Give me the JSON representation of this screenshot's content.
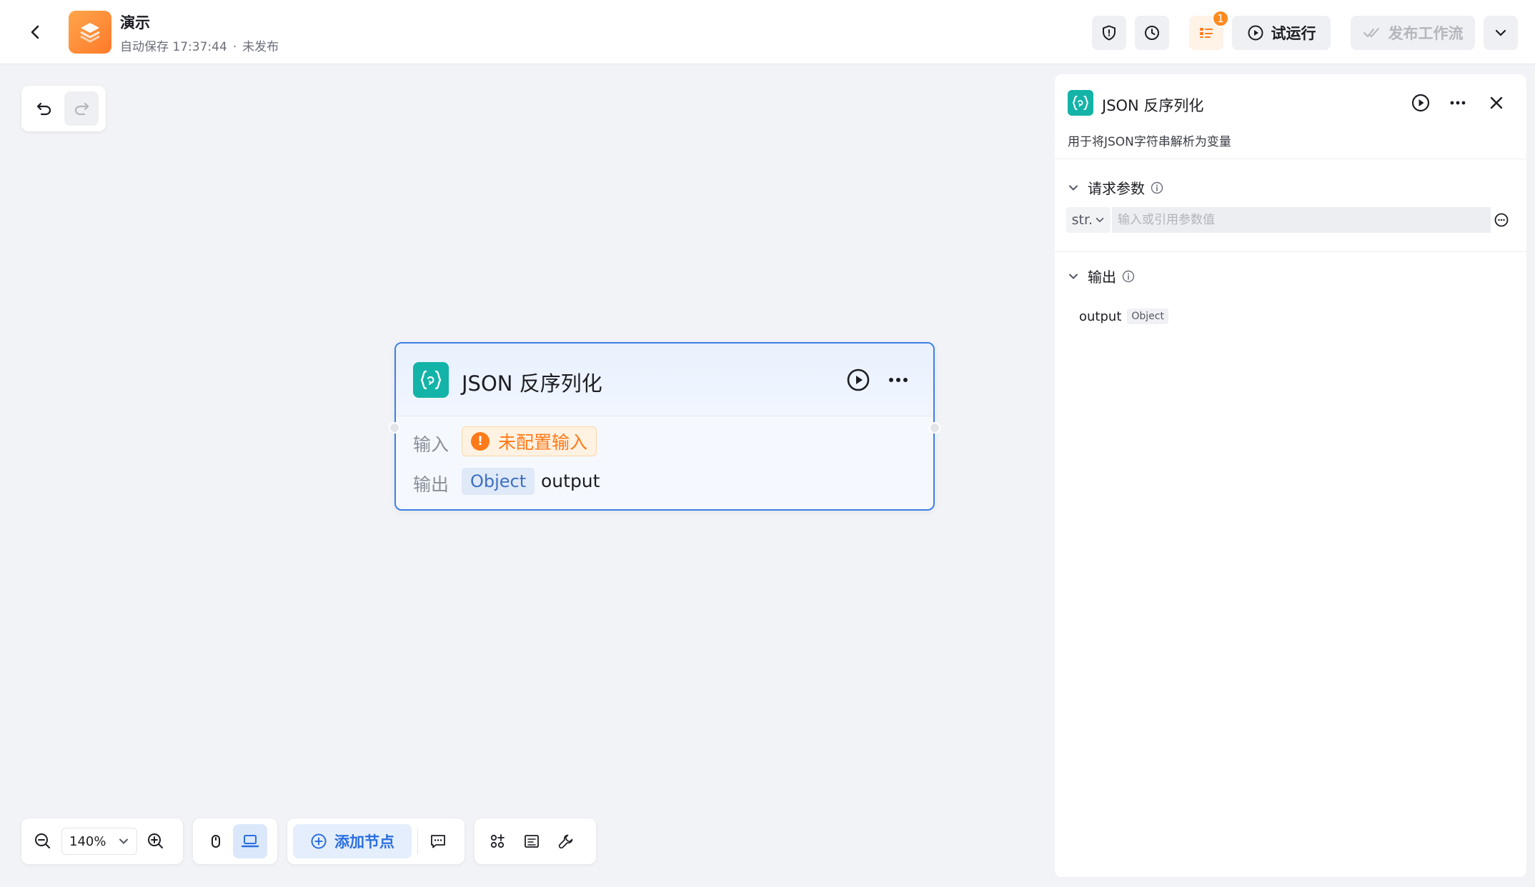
{
  "header": {
    "app_title": "演示",
    "save_status": "自动保存 17:37:44",
    "publish_status": "未发布",
    "problems_count": "1",
    "test_run_label": "试运行",
    "publish_label": "发布工作流"
  },
  "node": {
    "title": "JSON 反序列化",
    "input_label": "输入",
    "input_warning": "未配置输入",
    "output_label": "输出",
    "output_type": "Object",
    "output_name": "output"
  },
  "panel": {
    "title": "JSON 反序列化",
    "description": "用于将JSON字符串解析为变量",
    "request_section": "请求参数",
    "param_type": "str.",
    "param_placeholder": "输入或引用参数值",
    "output_section": "输出",
    "output_key": "output",
    "output_type": "Object"
  },
  "toolbar": {
    "zoom_level": "140%",
    "add_node_label": "添加节点"
  },
  "colors": {
    "brand_orange": "#ff7a2b",
    "node_accent": "#13b3a8",
    "selection_blue": "#3d7fe6",
    "warning": "#ff7a1a"
  },
  "icons": [
    "back-arrow-icon",
    "shield-icon",
    "clock-icon",
    "problems-list-icon",
    "play-icon",
    "double-check-icon",
    "chevron-down-icon",
    "undo-icon",
    "redo-icon",
    "json-braces-icon",
    "more-icon",
    "close-icon",
    "info-icon",
    "variable-ref-icon",
    "zoom-out-icon",
    "zoom-in-icon",
    "mouse-icon",
    "laptop-icon",
    "plus-circle-icon",
    "comment-icon",
    "plugins-icon",
    "note-icon",
    "wrench-icon"
  ]
}
